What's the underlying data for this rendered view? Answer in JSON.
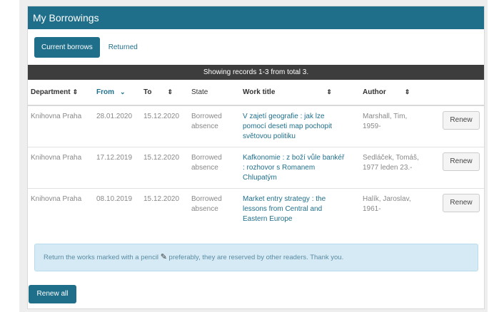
{
  "panel": {
    "title": "My Borrowings"
  },
  "tabs": [
    {
      "label": "Current borrows",
      "active": true
    },
    {
      "label": "Returned",
      "active": false
    }
  ],
  "records_info": "Showing records 1-3 from total 3.",
  "table": {
    "headers": {
      "department": "Department",
      "from": "From",
      "to": "To",
      "state": "State",
      "work_title": "Work title",
      "author": "Author"
    },
    "rows": [
      {
        "department": "Knihovna Praha",
        "from": "28.01.2020",
        "to": "15.12.2020",
        "state_l1": "Borrowed",
        "state_l2": "absence",
        "title_l1": "V zajetí geografie : jak lze",
        "title_l2": "pomocí deseti map pochopit",
        "title_l3": "světovou politiku",
        "author_l1": "Marshall, Tim,",
        "author_l2": "1959-",
        "action": "Renew"
      },
      {
        "department": "Knihovna Praha",
        "from": "17.12.2019",
        "to": "15.12.2020",
        "state_l1": "Borrowed",
        "state_l2": "absence",
        "title_l1": "Kafkonomie : z boží vůle bankéř",
        "title_l2": ": rozhovor s Romanem",
        "title_l3": "Chlupatým",
        "author_l1": "Sedláček, Tomáš,",
        "author_l2": "1977 leden 23.-",
        "action": "Renew"
      },
      {
        "department": "Knihovna Praha",
        "from": "08.10.2019",
        "to": "15.12.2020",
        "state_l1": "Borrowed",
        "state_l2": "absence",
        "title_l1": "Market entry strategy : the",
        "title_l2": "lessons from Central and",
        "title_l3": "Eastern Europe",
        "author_l1": "Halík, Jaroslav,",
        "author_l2": "1961-",
        "action": "Renew"
      }
    ]
  },
  "alert": {
    "text_before": "Return the works marked with a pencil",
    "icon": "pencil-icon",
    "text_after": "preferably, they are reserved by other readers. Thank you."
  },
  "renew_all_label": "Renew all",
  "colors": {
    "primary": "#1f6f8b",
    "records_bar": "#3d3d3d",
    "alert_bg": "#d5eaf4"
  }
}
